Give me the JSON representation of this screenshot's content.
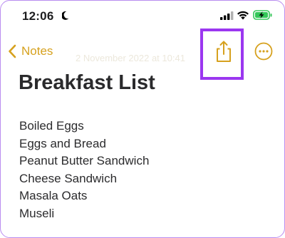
{
  "status_bar": {
    "time": "12:06",
    "icons": [
      "moon-icon",
      "cellular-signal-icon",
      "wifi-icon",
      "battery-charging-icon"
    ]
  },
  "nav": {
    "back_label": "Notes",
    "faded_date": "2 November 2022 at 10:41",
    "icons": [
      "chevron-left-icon",
      "share-icon",
      "more-options-icon"
    ]
  },
  "note": {
    "title": "Breakfast List",
    "items": [
      "Boiled Eggs",
      "Eggs and Bread",
      "Peanut Butter Sandwich",
      "Cheese Sandwich",
      "Masala Oats",
      "Museli"
    ]
  },
  "colors": {
    "accent": "#d6a11e",
    "highlight": "#9b37f0",
    "text": "#2b2b2d",
    "battery": "#34c759"
  }
}
